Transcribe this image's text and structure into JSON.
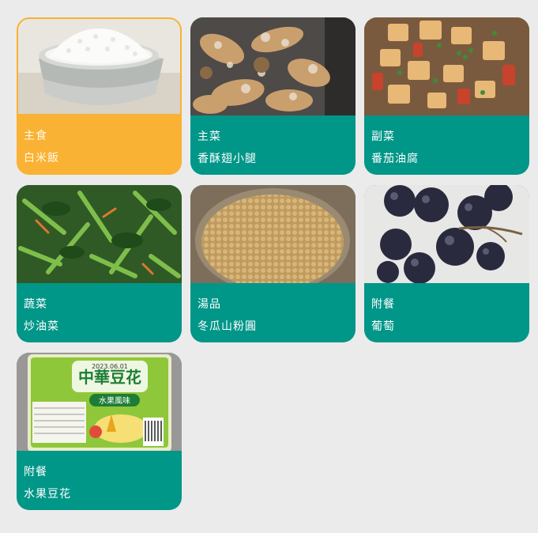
{
  "menu": {
    "items": [
      {
        "category": "主食",
        "dish": "白米飯",
        "selected": true,
        "photo": "rice-bowl-photo"
      },
      {
        "category": "主菜",
        "dish": "香酥翅小腿",
        "selected": false,
        "photo": "fried-drumettes-photo"
      },
      {
        "category": "副菜",
        "dish": "番茄油腐",
        "selected": false,
        "photo": "tomato-tofu-photo"
      },
      {
        "category": "蔬菜",
        "dish": "炒油菜",
        "selected": false,
        "photo": "stir-fried-greens-photo"
      },
      {
        "category": "湯品",
        "dish": "冬瓜山粉圓",
        "selected": false,
        "photo": "winter-melon-tapioca-soup-photo"
      },
      {
        "category": "附餐",
        "dish": "葡萄",
        "selected": false,
        "photo": "grapes-photo"
      },
      {
        "category": "附餐",
        "dish": "水果豆花",
        "selected": false,
        "photo": "fruit-douhua-package-photo"
      }
    ]
  },
  "colors": {
    "card_default": "#009688",
    "card_selected": "#f9b233",
    "background": "#ebebeb"
  },
  "package": {
    "brand": "中華豆花",
    "flavor": "水果風味",
    "date": "2023.06.01"
  }
}
